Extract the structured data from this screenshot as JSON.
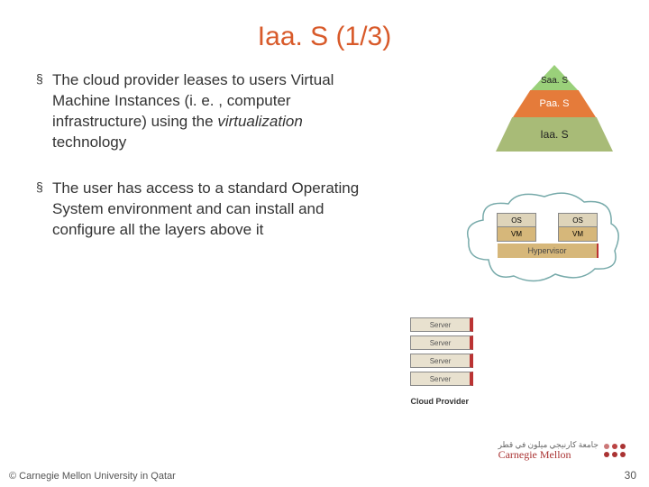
{
  "title": "Iaa. S (1/3)",
  "bullets": [
    "The cloud provider leases to users Virtual Machine Instances (i. e. , computer infrastructure) using the <em>virtualization</em> technology",
    "The user has access to a standard Operating System environment and can install and configure all the layers above it"
  ],
  "pyramid": {
    "top": "Saa. S",
    "mid": "Paa. S",
    "bot": "Iaa. S"
  },
  "cloud": {
    "os": "OS",
    "vm": "VM",
    "hypervisor": "Hypervisor"
  },
  "server_label": "Server",
  "cloud_provider_label": "Cloud Provider",
  "logo": {
    "line1": "Carnegie Mellon",
    "arabic": "جامعة كارنيجي ميلون في قطر"
  },
  "footer": "© Carnegie Mellon University in Qatar",
  "pagenum": "30"
}
